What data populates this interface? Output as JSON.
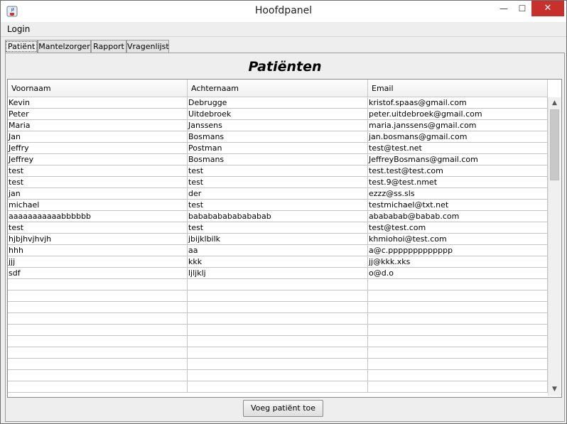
{
  "window": {
    "title": "Hoofdpanel",
    "controls": {
      "minimize": "—",
      "maximize": "☐",
      "close": "✕"
    }
  },
  "menu": {
    "items": [
      {
        "label": "Login"
      }
    ]
  },
  "tabs": [
    {
      "label": "Patiënt",
      "active": true
    },
    {
      "label": "Mantelzorger",
      "active": false
    },
    {
      "label": "Rapport",
      "active": false
    },
    {
      "label": "Vragenlijst",
      "active": false
    }
  ],
  "panel": {
    "heading": "Patiënten",
    "table": {
      "columns": [
        "Voornaam",
        "Achternaam",
        "Email"
      ],
      "rows": [
        [
          "Kevin",
          "Debrugge",
          "kristof.spaas@gmail.com"
        ],
        [
          "Peter",
          "Uitdebroek",
          "peter.uitdebroek@gmail.com"
        ],
        [
          "Maria",
          "Janssens",
          "maria.janssens@gmail.com"
        ],
        [
          "Jan",
          "Bosmans",
          "jan.bosmans@gmail.com"
        ],
        [
          "Jeffry",
          "Postman",
          "test@test.net"
        ],
        [
          "Jeffrey",
          "Bosmans",
          "JeffreyBosmans@gmail.com"
        ],
        [
          "test",
          "test",
          "test.test@test.com"
        ],
        [
          "test",
          "test",
          "test.9@test.nmet"
        ],
        [
          "jan",
          "der",
          "ezzz@ss.sls"
        ],
        [
          "michael",
          "test",
          "testmichael@txt.net"
        ],
        [
          "aaaaaaaaaaabbbbbb",
          "babababababababab",
          "abababab@babab.com"
        ],
        [
          "test",
          "test",
          "test@test.com"
        ],
        [
          "hjbjhvjhvjh",
          "jbijklbilk",
          "khmiohoi@test.com"
        ],
        [
          "hhh",
          "aa",
          "a@c.ppppppppppppp"
        ],
        [
          "jjj",
          "kkk",
          "jj@kkk.xks"
        ],
        [
          "sdf",
          "ljljklj",
          "o@d.o"
        ]
      ],
      "empty_rows": 10
    },
    "scrollbar": {
      "up": "▲",
      "down": "▼"
    },
    "add_button": "Voeg patiënt toe"
  }
}
